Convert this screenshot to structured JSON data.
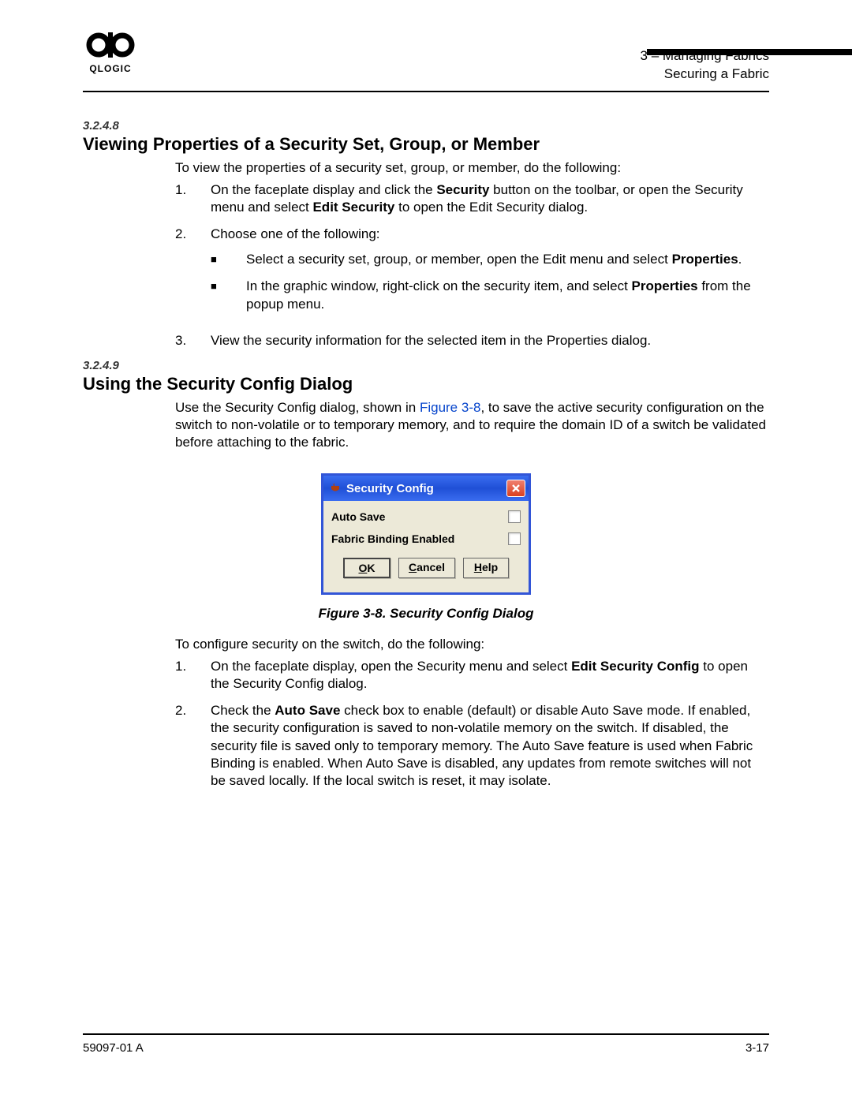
{
  "header": {
    "chapter_line": "3 – Managing Fabrics",
    "section_line": "Securing a Fabric"
  },
  "section1": {
    "number": "3.2.4.8",
    "title": "Viewing Properties of a Security Set, Group, or Member",
    "intro": "To view the properties of a security set, group, or member, do the following:",
    "steps": [
      {
        "n": "1.",
        "pre": "On the faceplate display and click the ",
        "b1": "Security",
        "mid": " button on the toolbar, or open the Security menu and select ",
        "b2": "Edit Security",
        "post": " to open the Edit Security dialog."
      },
      {
        "n": "2.",
        "text": "Choose one of the following:",
        "bullets": [
          {
            "pre": "Select a security set, group, or member, open the Edit menu and select ",
            "b": "Properties",
            "post": "."
          },
          {
            "pre": "In the graphic window, right-click on the security item, and select ",
            "b": "Properties",
            "post": " from the popup menu."
          }
        ]
      },
      {
        "n": "3.",
        "text": "View the security information for the selected item in the Properties dialog."
      }
    ]
  },
  "section2": {
    "number": "3.2.4.9",
    "title": "Using the Security Config Dialog",
    "intro_pre": "Use the Security Config dialog, shown in ",
    "intro_link": "Figure 3-8",
    "intro_post": ", to save the active security configuration on the switch to non-volatile or to temporary memory, and to require the domain ID of a switch be validated before attaching to the fabric.",
    "figure_caption": "Figure 3-8.  Security Config Dialog",
    "post_intro": "To configure security on the switch, do the following:",
    "steps": [
      {
        "n": "1.",
        "pre": "On the faceplate display, open the Security menu and select ",
        "b": "Edit Security Config",
        "post": " to open the Security Config dialog."
      },
      {
        "n": "2.",
        "pre": "Check the ",
        "b": "Auto Save",
        "post": " check box to enable (default) or disable Auto Save mode. If enabled, the security configuration is saved to non-volatile memory on the switch. If disabled, the security file is saved only to temporary memory. The Auto Save feature is used when Fabric Binding is enabled. When Auto Save is disabled, any updates from remote switches will not be saved locally. If the local switch is reset, it may isolate."
      }
    ]
  },
  "dialog": {
    "title": "Security Config",
    "row1": "Auto Save",
    "row2": "Fabric Binding Enabled",
    "ok": "OK",
    "cancel": "Cancel",
    "help": "Help"
  },
  "footer": {
    "left": "59097-01 A",
    "right": "3-17"
  }
}
